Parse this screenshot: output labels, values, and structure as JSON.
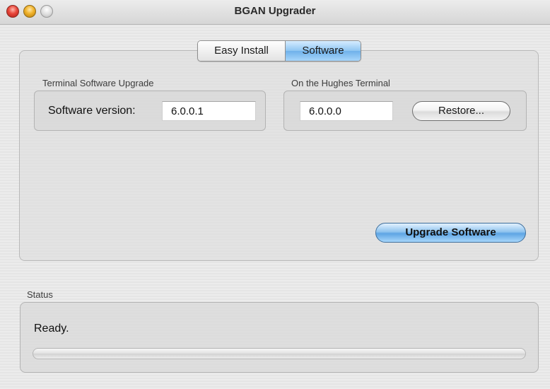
{
  "window": {
    "title": "BGAN Upgrader"
  },
  "tabs": [
    {
      "label": "Easy Install",
      "selected": false
    },
    {
      "label": "Software",
      "selected": true
    }
  ],
  "terminal_upgrade": {
    "group_label": "Terminal Software Upgrade",
    "software_version_label": "Software version:",
    "software_version_value": "6.0.0.1"
  },
  "hughes_terminal": {
    "group_label": "On the Hughes Terminal",
    "version_value": "6.0.0.0",
    "restore_label": "Restore..."
  },
  "actions": {
    "upgrade_label": "Upgrade Software"
  },
  "status": {
    "group_label": "Status",
    "text": "Ready.",
    "progress_fraction": 0
  },
  "colors": {
    "accent": "#6fb1ea",
    "window_bg": "#e9e9e9"
  }
}
